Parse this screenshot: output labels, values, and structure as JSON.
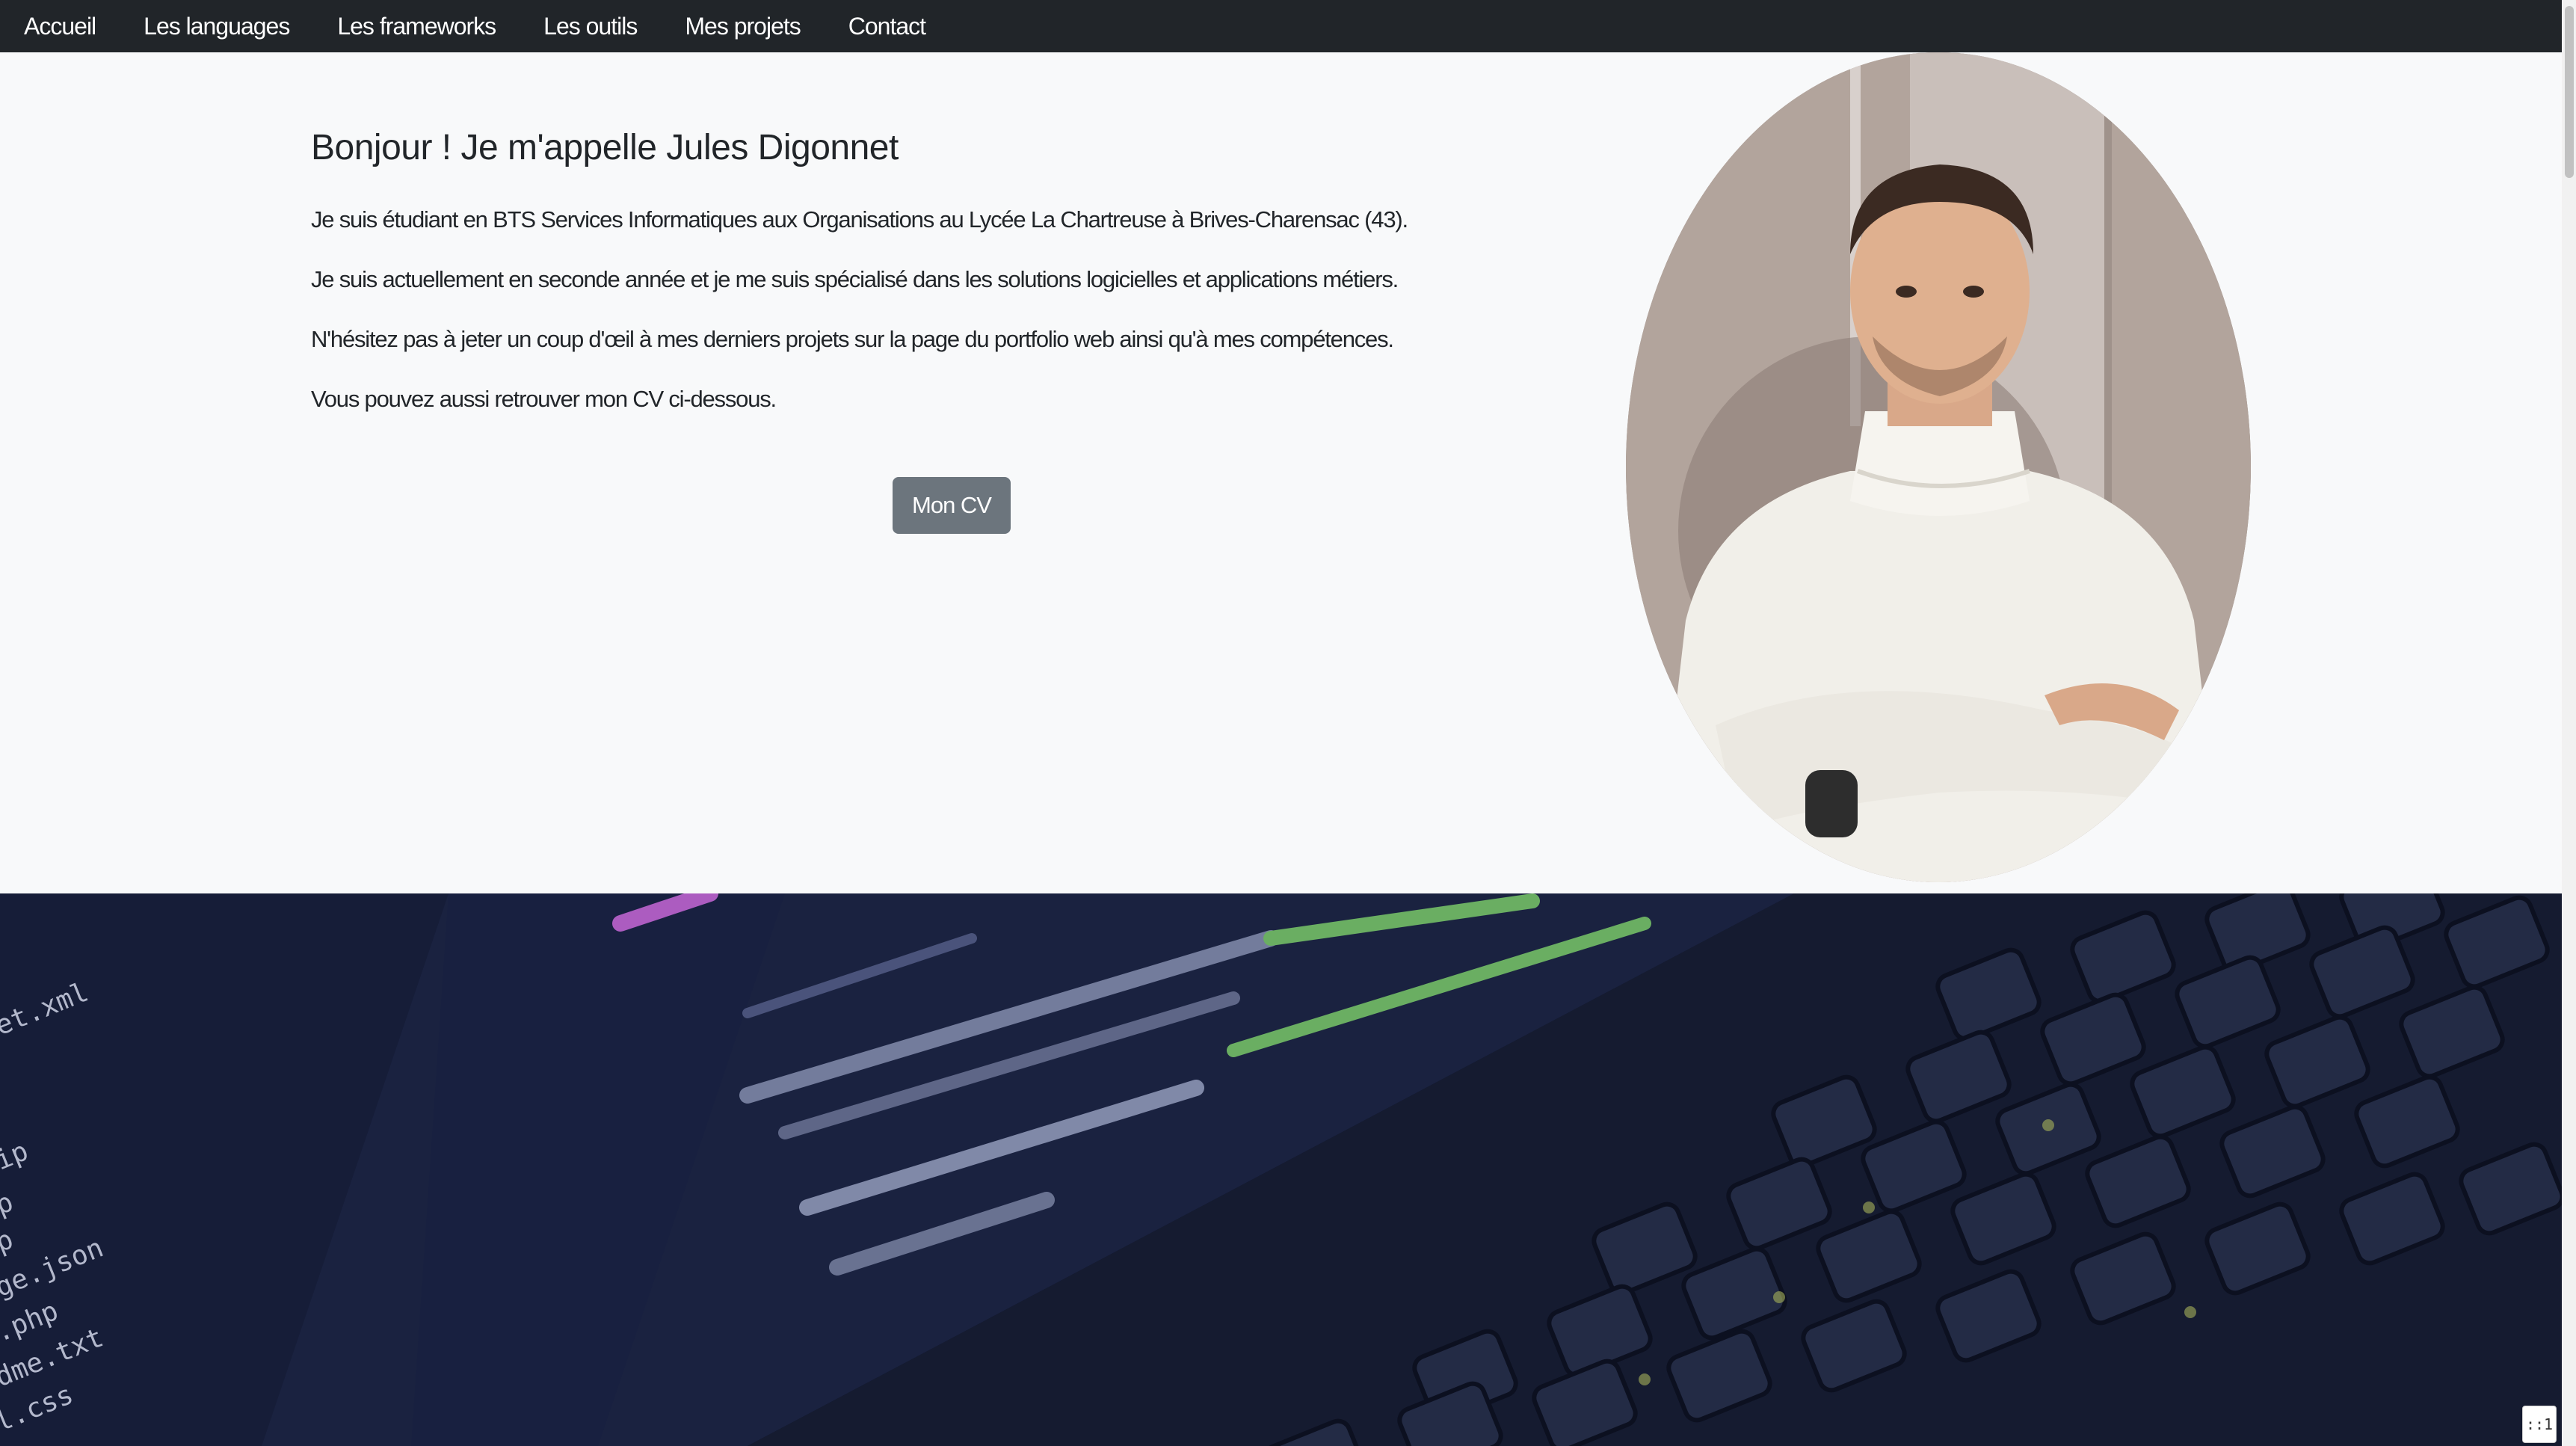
{
  "nav": {
    "items": [
      {
        "label": "Accueil"
      },
      {
        "label": "Les languages"
      },
      {
        "label": "Les frameworks"
      },
      {
        "label": "Les outils"
      },
      {
        "label": "Mes projets"
      },
      {
        "label": "Contact"
      }
    ]
  },
  "hero": {
    "title": "Bonjour ! Je m'appelle Jules Digonnet",
    "paragraphs": [
      "Je suis étudiant en BTS Services Informatiques aux Organisations au Lycée La Chartreuse à Brives-Charensac (43).",
      "Je suis actuellement en seconde année et je me suis spécialisé dans les solutions logicielles et applications métiers.",
      "N'hésitez pas à jeter un coup d'œil à mes derniers projets sur la page du portfolio web ainsi qu'à mes compétences.",
      "Vous pouvez aussi retrouver mon CV ci-dessous."
    ],
    "cv_button": "Mon CV"
  },
  "colors": {
    "navbar_bg": "#212529",
    "page_bg": "#f8f9fa",
    "button_bg": "#6c757d"
  },
  "badge": {
    "text": "::1"
  }
}
